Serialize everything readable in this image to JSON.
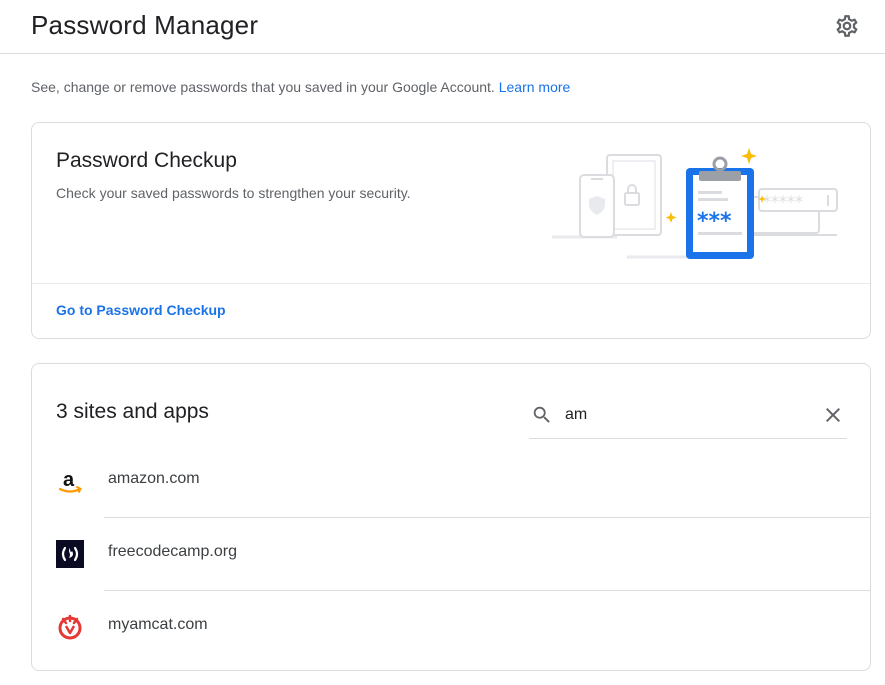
{
  "header": {
    "title": "Password Manager",
    "settings_icon": "gear-icon"
  },
  "intro": {
    "text": "See, change or remove passwords that you saved in your Google Account.",
    "link": "Learn more"
  },
  "checkup": {
    "title": "Password Checkup",
    "description": "Check your saved passwords to strengthen your security.",
    "link": "Go to Password Checkup",
    "illustration_text": "***",
    "colors": {
      "accent": "#1a73e8",
      "star": "#fbbc04"
    }
  },
  "sites": {
    "title": "3 sites and apps",
    "search": {
      "value": "am",
      "placeholder": "Search passwords"
    },
    "items": [
      {
        "name": "amazon.com",
        "icon": "amazon-icon"
      },
      {
        "name": "freecodecamp.org",
        "icon": "freecodecamp-icon"
      },
      {
        "name": "myamcat.com",
        "icon": "myamcat-icon"
      }
    ]
  }
}
